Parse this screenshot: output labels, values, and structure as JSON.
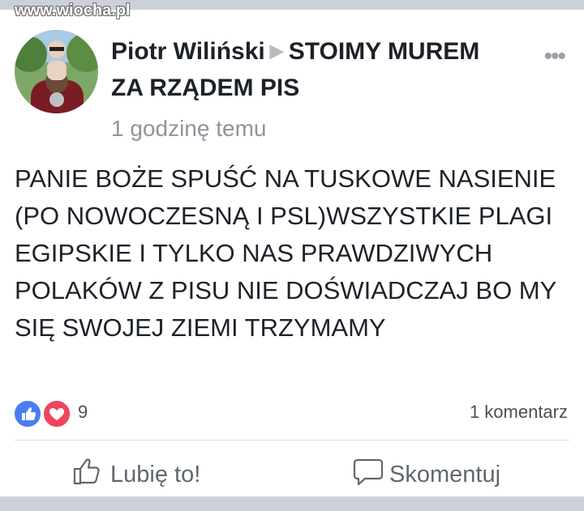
{
  "watermark": "www.wiocha.pl",
  "post": {
    "author": "Piotr Wiliński",
    "group": "STOIMY MUREM ZA RZĄDEM PIS",
    "time": "1 godzinę temu",
    "body": "PANIE BOŻE SPUŚĆ NA TUSKOWE NASIENIE (PO NOWOCZESNĄ I PSL)WSZYSTKIE PLAGI EGIPSKIE I TYLKO NAS PRAWDZIWYCH POLAKÓW Z PISU NIE DOŚWIADCZAJ BO MY SIĘ SWOJEJ ZIEMI TRZYMAMY"
  },
  "stats": {
    "reaction_count": "9",
    "comments": "1 komentarz"
  },
  "actions": {
    "like": "Lubię to!",
    "comment": "Skomentuj"
  },
  "icons": {
    "menu": "more-dots-icon",
    "like": "thumbs-up-icon",
    "comment": "speech-bubble-icon"
  },
  "colors": {
    "like_reaction": "#4a7df0",
    "love_reaction": "#f0445f",
    "text": "#1d2129",
    "muted": "#90949c"
  }
}
